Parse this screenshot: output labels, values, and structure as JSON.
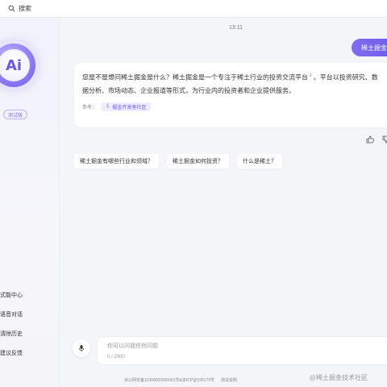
{
  "search": {
    "placeholder": "搜索"
  },
  "sidebar": {
    "avatar_text": "Ai",
    "badge": "测试版",
    "items": [
      {
        "label": "式能中心"
      },
      {
        "label": "语音对话"
      },
      {
        "label": "清除历史"
      },
      {
        "label": "建议反馈"
      }
    ]
  },
  "chat": {
    "time": "13:11",
    "user_message": "稀土掘金",
    "bot": {
      "line1": "您是不是想问稀土掘金是什么？稀土掘金是一个专注于稀土行业的投资交流平台",
      "cite": "1",
      "line1_tail": "。平台以投资研究、数",
      "line2": "据分析、市场动态、企业报道等形式，为行业内的投资者和企业提供服务。",
      "ref_label": "参考：",
      "ref_num": "1",
      "ref_name": "掘金开发者社区"
    },
    "actions": [
      "like-icon",
      "dislike-icon"
    ],
    "suggestions": [
      {
        "label": "稀土掘金有哪些行业和领域？"
      },
      {
        "label": "稀土掘金如何投资？"
      },
      {
        "label": "什么是稀土？"
      }
    ]
  },
  "composer": {
    "placeholder": "你可以问我任何问题",
    "count": "0 / 2000"
  },
  "footer": {
    "icp": "京公网安备11000002000001号&京ICP证030173号",
    "statement": "测试说明"
  },
  "watermark": "@稀土掘金技术社区",
  "colors": {
    "accent": "#6a5ae8",
    "background": "#f4f5f9"
  }
}
